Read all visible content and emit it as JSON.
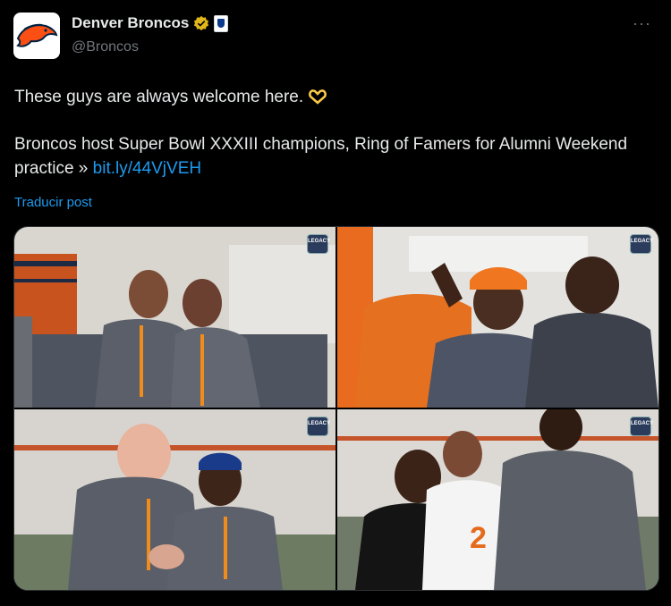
{
  "author": {
    "display_name": "Denver Broncos",
    "handle": "@Broncos",
    "avatar_icon": "broncos-logo-icon",
    "verified_color": "#e2b719"
  },
  "post": {
    "line1": "These guys are always welcome here.",
    "line2": "Broncos host Super Bowl XXXIII champions, Ring of Famers for Alumni Weekend practice »",
    "link": "bit.ly/44VjVEH",
    "translate_label": "Traducir post",
    "emoji_icon": "heart-hands-icon"
  },
  "menu": {
    "more_label": "···"
  },
  "media": {
    "photo_1": {
      "description": "photo-two-men-ring-gesture",
      "watermark": "LEGACY"
    },
    "photo_2": {
      "description": "photo-players-huddle",
      "watermark": "LEGACY"
    },
    "photo_3": {
      "description": "photo-alumni-embrace",
      "watermark": "LEGACY"
    },
    "photo_4": {
      "description": "photo-player-greeting-alumni",
      "watermark": "LEGACY"
    }
  },
  "colors": {
    "accent": "#1d9bf0",
    "background": "#000000",
    "text": "#e7e9ea",
    "muted": "#71767b",
    "broncos_orange": "#fb4f14",
    "broncos_navy": "#002244"
  }
}
